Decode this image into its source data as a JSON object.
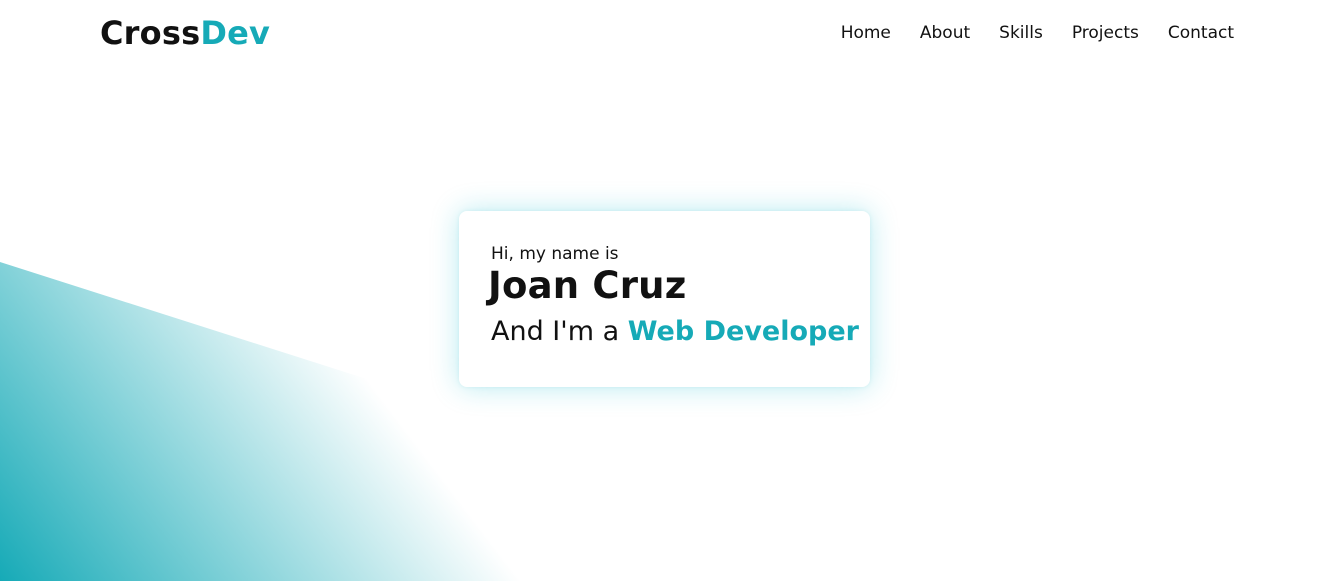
{
  "brand": {
    "logo_primary": "Cross",
    "logo_accent": "Dev",
    "accent_color": "#16aab7"
  },
  "nav": {
    "items": [
      {
        "label": "Home"
      },
      {
        "label": "About"
      },
      {
        "label": "Skills"
      },
      {
        "label": "Projects"
      },
      {
        "label": "Contact"
      }
    ]
  },
  "hero": {
    "greeting": "Hi, my name is",
    "name": "Joan Cruz",
    "role_prefix": "And I'm a",
    "role": "Web Developer"
  },
  "theme": {
    "background": "#ffffff",
    "text": "#111111",
    "gradient_start": "#16aab7",
    "gradient_end": "#ffffff"
  }
}
